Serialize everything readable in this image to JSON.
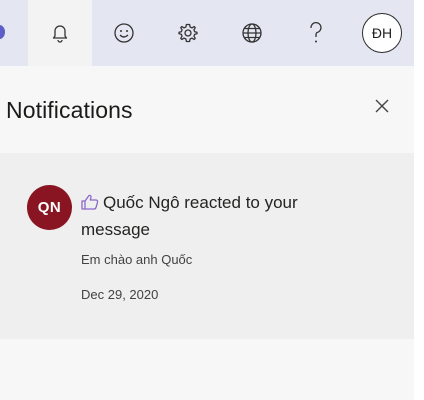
{
  "header": {
    "buttons": [
      {
        "name": "notifications-button",
        "icon": "bell-icon"
      },
      {
        "name": "feedback-button",
        "icon": "smiley-icon"
      },
      {
        "name": "settings-button",
        "icon": "gear-icon"
      },
      {
        "name": "language-button",
        "icon": "globe-icon"
      },
      {
        "name": "help-button",
        "icon": "question-icon"
      }
    ],
    "user_initials": "ĐH"
  },
  "notifications": {
    "title": "Notifications",
    "close_icon": "close-icon",
    "items": [
      {
        "avatar_initials": "QN",
        "avatar_color": "#8a1522",
        "reaction_icon": "thumbs-up-icon",
        "text": "Quốc Ngô reacted to your message",
        "preview": "Em chào anh Quốc",
        "date": "Dec 29, 2020"
      }
    ]
  },
  "colors": {
    "topbar_bg": "#e4e7f2",
    "accent": "#5b5fc7",
    "panel_bg": "#f7f7f7",
    "card_bg": "#efefef"
  }
}
